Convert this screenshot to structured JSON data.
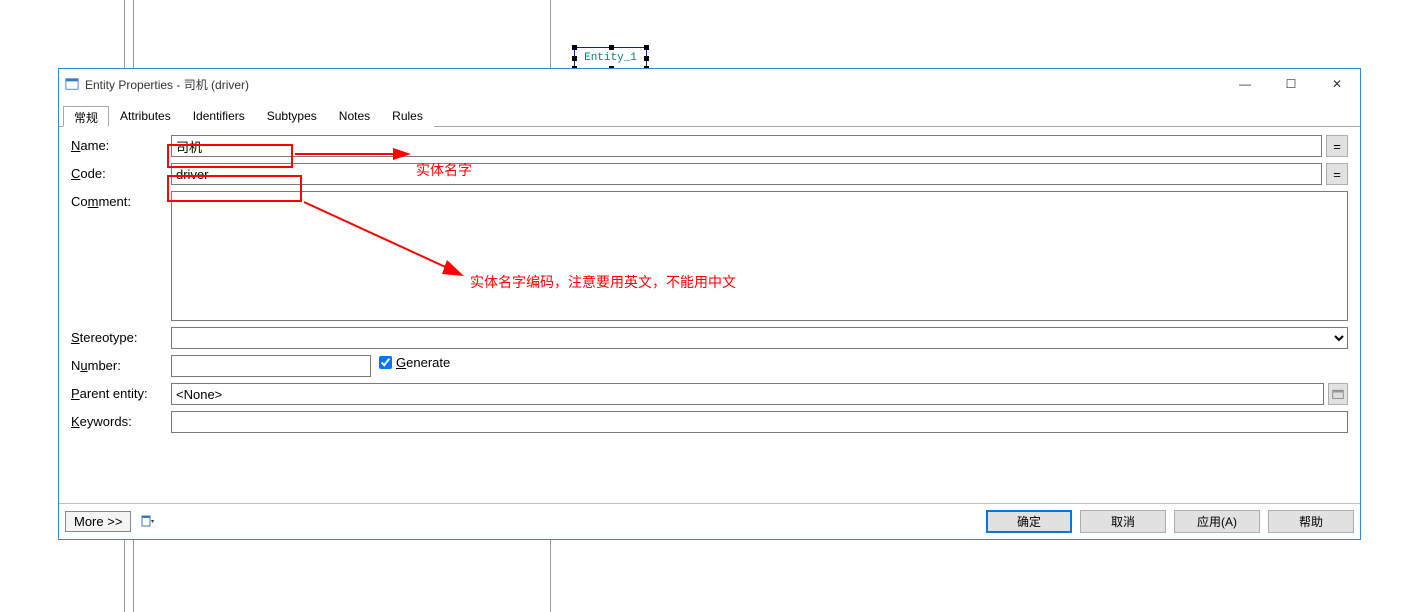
{
  "background": {
    "entity_label": "Entity_1"
  },
  "window": {
    "title": "Entity Properties - 司机 (driver)",
    "controls": {
      "minimize": "—",
      "maximize": "☐",
      "close": "✕"
    }
  },
  "tabs": [
    {
      "key": "general",
      "label": "常规",
      "active": true
    },
    {
      "key": "attributes",
      "label": "Attributes",
      "active": false
    },
    {
      "key": "identifiers",
      "label": "Identifiers",
      "active": false
    },
    {
      "key": "subtypes",
      "label": "Subtypes",
      "active": false
    },
    {
      "key": "notes",
      "label": "Notes",
      "active": false
    },
    {
      "key": "rules",
      "label": "Rules",
      "active": false
    }
  ],
  "form": {
    "name": {
      "label": "Name:",
      "value": "司机",
      "eq": "="
    },
    "code": {
      "label": "Code:",
      "value": "driver",
      "eq": "="
    },
    "comment": {
      "label": "Comment:",
      "value": ""
    },
    "stereotype": {
      "label": "Stereotype:",
      "value": ""
    },
    "number": {
      "label": "Number:",
      "value": ""
    },
    "generate": {
      "label": "Generate",
      "checked": true
    },
    "parent": {
      "label": "Parent entity:",
      "value": "<None>"
    },
    "keywords": {
      "label": "Keywords:",
      "value": ""
    }
  },
  "bottom": {
    "more": "More >>",
    "ok": "确定",
    "cancel": "取消",
    "apply": "应用(A)",
    "help": "帮助"
  },
  "annotations": {
    "name_note": "实体名字",
    "code_note": "实体名字编码，注意要用英文，不能用中文"
  }
}
